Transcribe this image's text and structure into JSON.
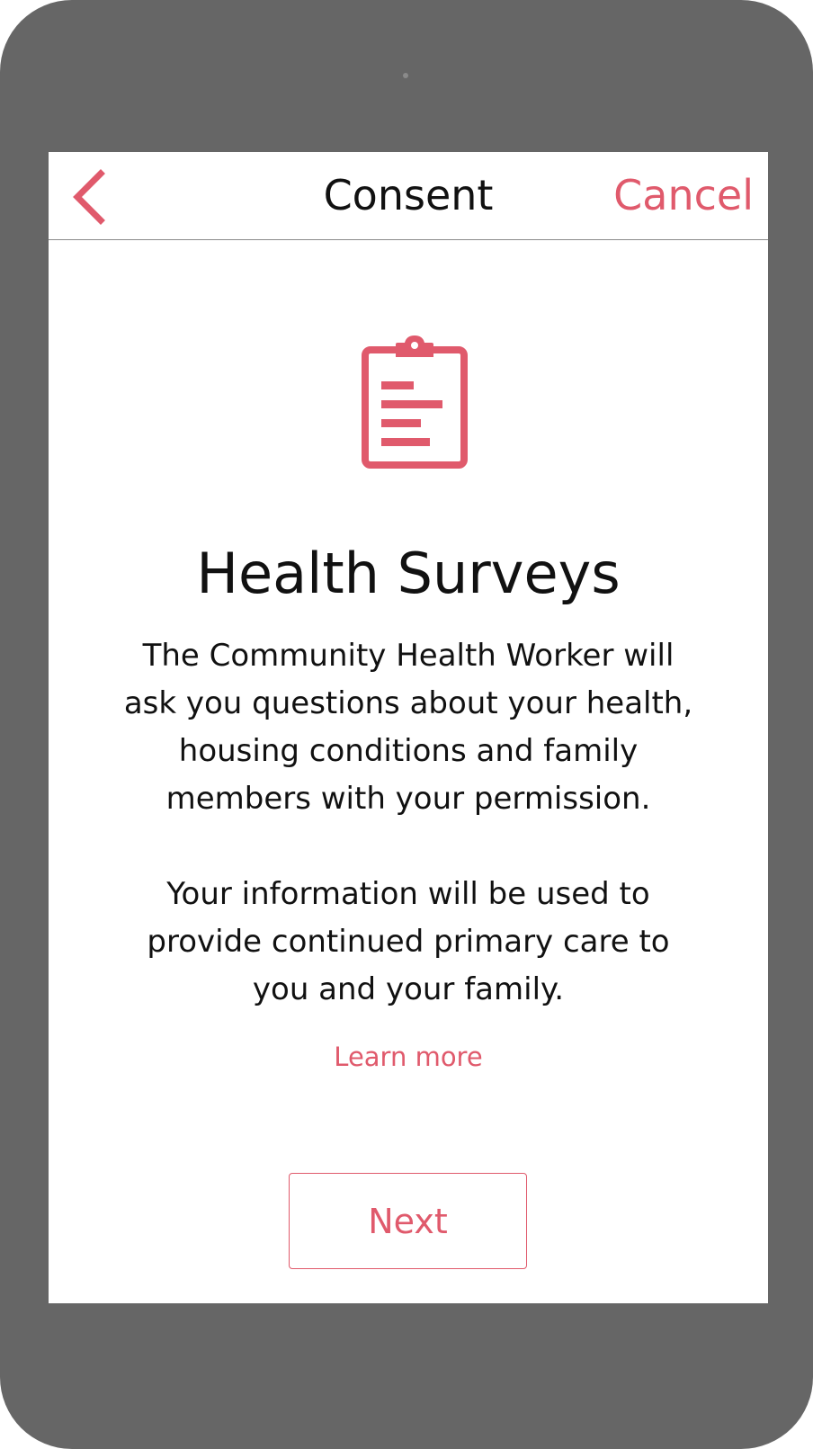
{
  "colors": {
    "accent": "#e05a6c",
    "device_frame": "#666666",
    "text": "#111111"
  },
  "navbar": {
    "back_icon": "chevron-left-icon",
    "title": "Consent",
    "cancel_label": "Cancel"
  },
  "content": {
    "icon": "clipboard-icon",
    "heading": "Health Surveys",
    "paragraph_1": "The Community Health Worker will\nask you questions about your health,\nhousing conditions and family\nmembers with your permission.",
    "paragraph_2": "Your information will be used to\nprovide continued primary care to\nyou and your family.",
    "learn_more_label": "Learn more",
    "next_label": "Next"
  }
}
